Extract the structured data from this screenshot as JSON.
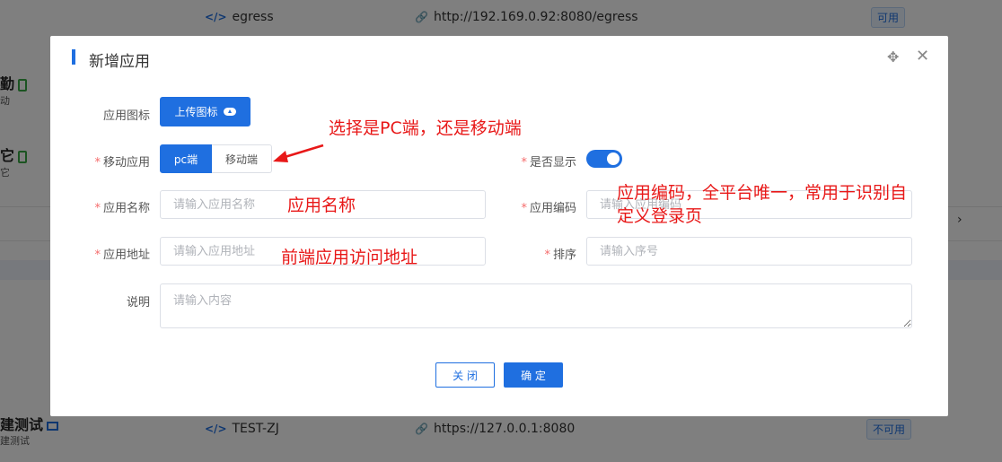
{
  "background": {
    "rows": [
      {
        "code": "egress",
        "url": "http://192.169.0.92:8080/egress",
        "status": "可用"
      },
      {
        "code": "TEST-ZJ",
        "url": "https://127.0.0.1:8080",
        "status": "不可用"
      }
    ],
    "left_items": [
      {
        "title": "勤",
        "subtitle": "动"
      },
      {
        "title": "它",
        "subtitle": "它"
      },
      {
        "title": "建测试",
        "subtitle": "建测试"
      }
    ],
    "right_bits": "›"
  },
  "dialog": {
    "title": "新增应用",
    "fields": {
      "icon_label": "应用图标",
      "upload_label": "上传图标",
      "mobile_label": "移动应用",
      "pc_option": "pc端",
      "mobile_option": "移动端",
      "show_label": "是否显示",
      "name_label": "应用名称",
      "name_placeholder": "请输入应用名称",
      "code_label": "应用编码",
      "code_placeholder": "请输入应用编码",
      "address_label": "应用地址",
      "address_placeholder": "请输入应用地址",
      "sort_label": "排序",
      "sort_placeholder": "请输入序号",
      "desc_label": "说明",
      "desc_placeholder": "请输入内容"
    },
    "required_mark": "*",
    "show_enabled": true,
    "cancel_label": "关 闭",
    "confirm_label": "确 定"
  },
  "annotations": {
    "pc_or_mobile": "选择是PC端，还是移动端",
    "app_name": "应用名称",
    "app_code": "应用编码，全平台唯一，常用于识别自定义登录页",
    "app_address": "前端应用访问地址"
  },
  "colors": {
    "primary": "#1f6fe0",
    "annotation": "#e81818",
    "required": "#f56c6c"
  }
}
